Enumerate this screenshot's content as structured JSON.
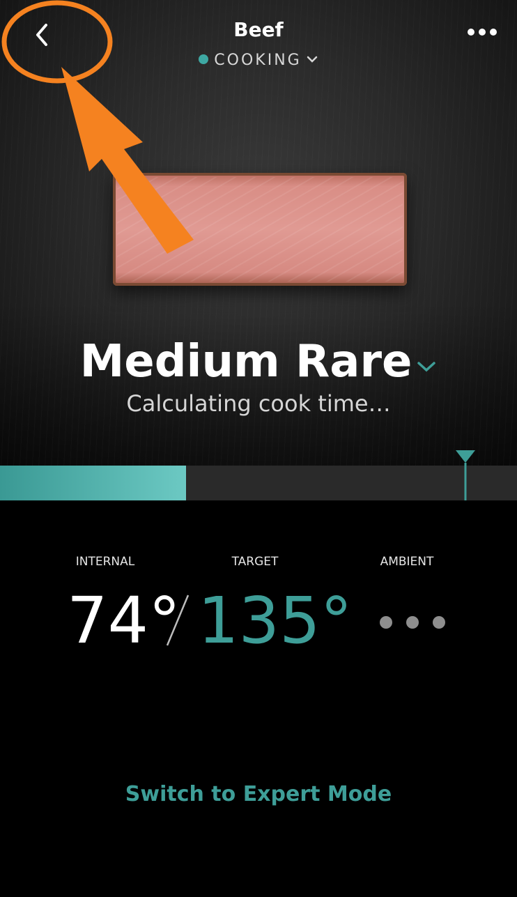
{
  "header": {
    "title": "Beef",
    "status_label": "COOKING",
    "status_color": "#3ea8a3"
  },
  "doneness": {
    "label": "Medium Rare",
    "subtitle": "Calculating cook time…"
  },
  "progress": {
    "fill_fraction": 0.36,
    "target_fraction": 0.9,
    "accent_color": "#3e9e98"
  },
  "temperatures": {
    "internal_label": "INTERNAL",
    "internal_value": "74°",
    "target_label": "TARGET",
    "target_value": "135°",
    "ambient_label": "AMBIENT"
  },
  "footer": {
    "switch_label": "Switch to Expert Mode"
  },
  "icons": {
    "back": "chevron-left-icon",
    "more": "more-horizontal-icon",
    "status_dropdown": "chevron-down-icon",
    "doneness_dropdown": "chevron-down-icon",
    "ambient_loading": "loading-dots-icon"
  },
  "annotation_color": "#f58220"
}
